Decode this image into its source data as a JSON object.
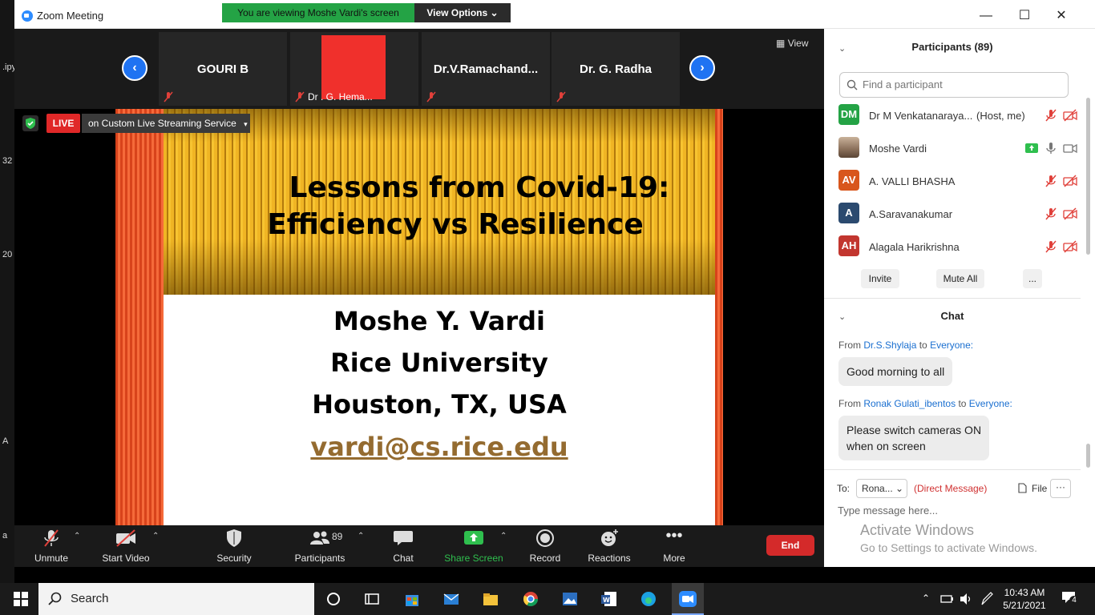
{
  "window": {
    "title": "Zoom Meeting"
  },
  "desktop_strip": {
    "texts": [
      ".ipy",
      "32",
      "20",
      "A",
      "a"
    ]
  },
  "share_banner": {
    "status": "You are viewing Moshe Vardi's screen",
    "options": "View Options"
  },
  "video_strip": {
    "tiles": [
      {
        "name": "GOURI B",
        "sub": ""
      },
      {
        "name": "",
        "sub": "Dr . G. Hema..."
      },
      {
        "name": "Dr.V.Ramachand...",
        "sub": ""
      },
      {
        "name": "Dr. G. Radha",
        "sub": ""
      }
    ],
    "view_label": "View"
  },
  "live": {
    "badge": "LIVE",
    "service": "on Custom Live Streaming Service"
  },
  "slide": {
    "title_line1": "Lessons from Covid-19:",
    "title_line2": "Efficiency vs Resilience",
    "author": "Moshe Y. Vardi",
    "affiliation": "Rice University",
    "location": "Houston, TX, USA",
    "email": "vardi@cs.rice.edu"
  },
  "toolbar": {
    "unmute": "Unmute",
    "start_video": "Start Video",
    "security": "Security",
    "participants": "Participants",
    "participants_count": "89",
    "chat": "Chat",
    "share_screen": "Share Screen",
    "record": "Record",
    "reactions": "Reactions",
    "more": "More",
    "end": "End"
  },
  "participants_panel": {
    "title": "Participants (89)",
    "search_placeholder": "Find a participant",
    "participants": [
      {
        "initials": "DM",
        "name": "Dr M Venkatanaraya...",
        "role": "(Host, me)",
        "color": "#24a345"
      },
      {
        "initials": "",
        "name": "Moshe Vardi",
        "role": "",
        "color": "#8a6f5a"
      },
      {
        "initials": "AV",
        "name": "A. VALLI BHASHA",
        "role": "",
        "color": "#d8561c"
      },
      {
        "initials": "A",
        "name": "A.Saravanakumar",
        "role": "",
        "color": "#2b4a6f"
      },
      {
        "initials": "AH",
        "name": "Alagala Harikrishna",
        "role": "",
        "color": "#c2362f"
      }
    ],
    "invite": "Invite",
    "mute_all": "Mute All",
    "more": "..."
  },
  "chat_panel": {
    "title": "Chat",
    "messages": [
      {
        "from_prefix": "From",
        "sender": "Dr.S.Shylaja",
        "to_word": "to",
        "recipient": "Everyone:",
        "text": "Good morning to all"
      },
      {
        "from_prefix": "From",
        "sender": "Ronak Gulati_ibentos",
        "to_word": "to",
        "recipient": "Everyone:",
        "text_line1": "Please switch cameras ON",
        "text_line2": "when on screen"
      }
    ],
    "to_label": "To:",
    "to_value": "Rona...",
    "direct": "(Direct Message)",
    "file": "File",
    "more": "···",
    "input_placeholder": "Type message here..."
  },
  "activation": {
    "line1": "Activate Windows",
    "line2": "Go to Settings to activate Windows."
  },
  "taskbar": {
    "search": "Search",
    "time": "10:43 AM",
    "date": "5/21/2021",
    "notif_count": "4"
  }
}
